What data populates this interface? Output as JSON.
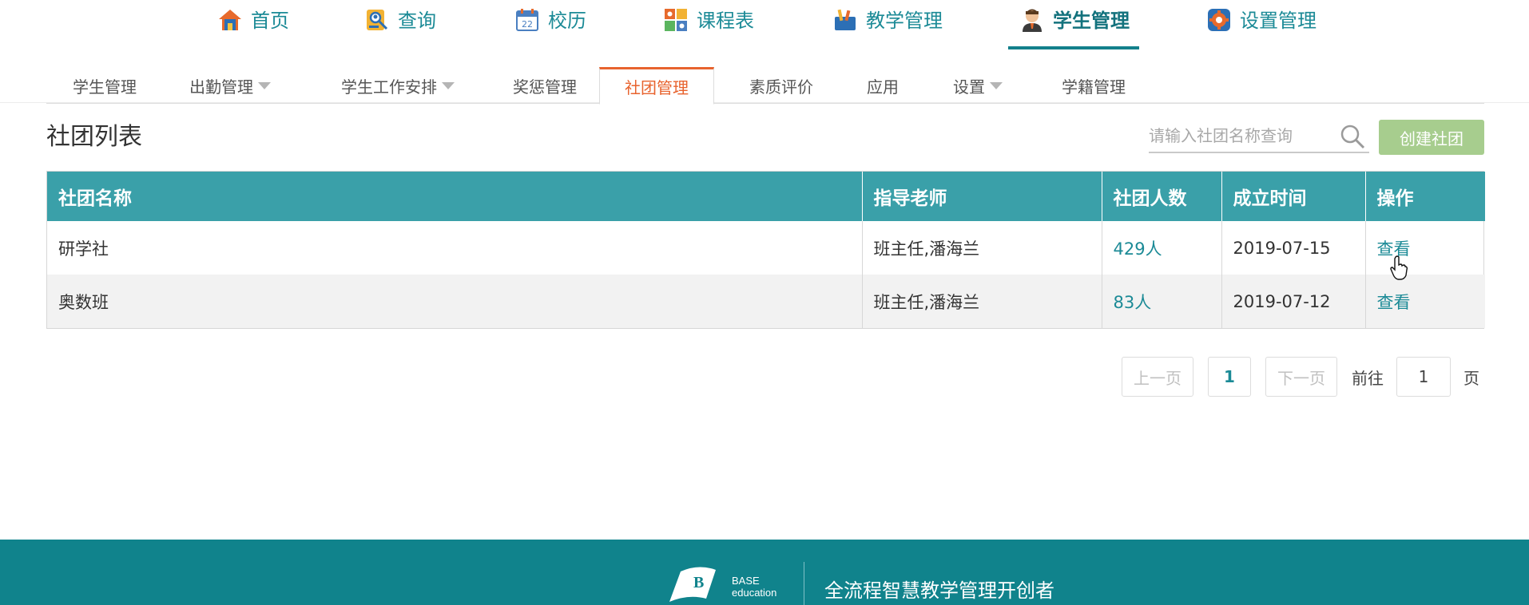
{
  "topnav": {
    "items": [
      {
        "label": "首页",
        "icon": "home-icon"
      },
      {
        "label": "查询",
        "icon": "search-person-icon"
      },
      {
        "label": "校历",
        "icon": "calendar-icon"
      },
      {
        "label": "课程表",
        "icon": "timetable-icon"
      },
      {
        "label": "教学管理",
        "icon": "teaching-icon"
      },
      {
        "label": "学生管理",
        "icon": "student-icon",
        "active": true
      },
      {
        "label": "设置管理",
        "icon": "settings-icon"
      }
    ]
  },
  "subnav": {
    "items": [
      {
        "label": "学生管理"
      },
      {
        "label": "出勤管理",
        "dropdown": true
      },
      {
        "label": "学生工作安排",
        "dropdown": true
      },
      {
        "label": "奖惩管理"
      },
      {
        "label": "社团管理",
        "active": true
      },
      {
        "label": "素质评价"
      },
      {
        "label": "应用"
      },
      {
        "label": "设置",
        "dropdown": true
      },
      {
        "label": "学籍管理"
      }
    ]
  },
  "page": {
    "title": "社团列表",
    "search_placeholder": "请输入社团名称查询",
    "create_label": "创建社团"
  },
  "table": {
    "columns": [
      "社团名称",
      "指导老师",
      "社团人数",
      "成立时间",
      "操作"
    ],
    "rows": [
      {
        "name": "研学社",
        "teacher": "班主任,潘海兰",
        "count": "429人",
        "date": "2019-07-15",
        "action": "查看"
      },
      {
        "name": "奥数班",
        "teacher": "班主任,潘海兰",
        "count": "83人",
        "date": "2019-07-12",
        "action": "查看"
      }
    ]
  },
  "pagination": {
    "prev": "上一页",
    "current": "1",
    "next": "下一页",
    "goto_label": "前往",
    "goto_value": "1",
    "page_suffix": "页"
  },
  "footer": {
    "logo_line1": "BASE",
    "logo_line2": "education",
    "slogan": "全流程智慧教学管理开创者"
  },
  "colors": {
    "primary": "#1b8a96",
    "table_header": "#3aa0a9",
    "active_tab": "#e8632e",
    "create_button": "#a7cd8e",
    "footer": "#10838c"
  }
}
